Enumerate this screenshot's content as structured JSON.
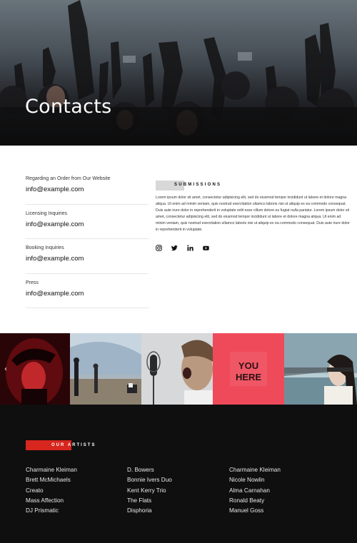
{
  "hero": {
    "title": "Contacts"
  },
  "contacts": [
    {
      "label": "Regarding an Order from Our Website",
      "email": "info@example.com"
    },
    {
      "label": "Licensing Inquiries",
      "email": "info@example.com"
    },
    {
      "label": "Booking Inquiries",
      "email": "info@example.com"
    },
    {
      "label": "Press",
      "email": "info@example.com"
    }
  ],
  "submissions": {
    "heading": "SUBMISSIONS",
    "body": "Lorem ipsum dolor sit amet, consectetur adipisicing elit, sed do eiusmod tempor incididunt ut labore et dolore magna aliqua. Ut enim ad minim veniam, quis nostrud exercitation ullamco laboris nisi ut aliquip ex ea commodo consequat. Duis aute irure dolor in reprehenderit in voluptate velit esse cillum dolore eu fugiat nulla pariatur. Lorem ipsum dolor sit amet, consectetur adipisicing elit, sed do eiusmod tempor incididunt ut labore et dolore magna aliqua. Ut enim ad minim veniam, quis nostrud exercitation ullamco laboris nisi ut aliquip ex ea commodo consequat. Duis aute irure dolor in reprehenderit in voluptate.",
    "socials": [
      "instagram-icon",
      "twitter-icon",
      "linkedin-icon",
      "youtube-icon"
    ]
  },
  "gallery": {
    "prev_arrow": "‹",
    "tiles": [
      "red-portrait",
      "beach-people",
      "boy-shouting-microphone",
      "you-here-sign",
      "blindfolded-woman"
    ]
  },
  "artists": {
    "heading": "OUR ARTISTS",
    "accent": "#d7261e",
    "columns": [
      [
        "Charmaine Kleiman",
        "Brett McMichaels",
        "Creato",
        "Mass Affection",
        "DJ Prismatic"
      ],
      [
        "D. Bowers",
        "Bonnie Ivers Duo",
        "Kent Kerry Trio",
        "The Flats",
        "Disphoria"
      ],
      [
        "Charmaine Kleiman",
        "Nicole Nowlin",
        "Alma Carnahan",
        "Ronald Beaty",
        "Manuel Goss"
      ]
    ]
  }
}
